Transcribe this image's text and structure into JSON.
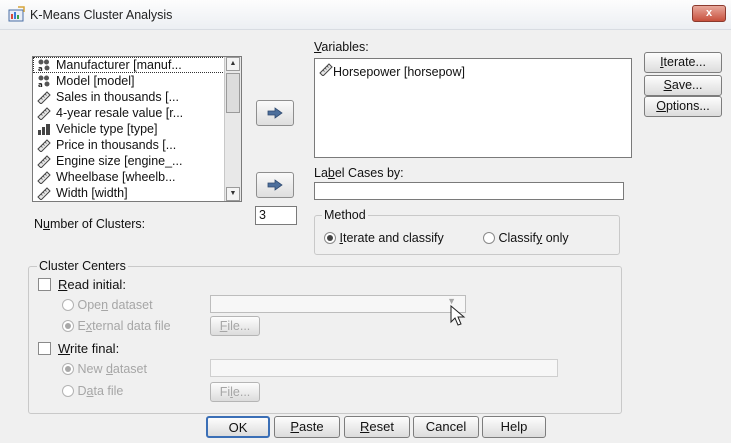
{
  "window": {
    "title": "K-Means Cluster Analysis",
    "close_label": "x"
  },
  "source_variables": [
    {
      "label": "Manufacturer [manuf...",
      "icon": "nominal-string-icon"
    },
    {
      "label": "Model [model]",
      "icon": "nominal-string-icon"
    },
    {
      "label": "Sales in thousands [...",
      "icon": "scale-ruler-icon"
    },
    {
      "label": "4-year resale value [r...",
      "icon": "scale-ruler-icon"
    },
    {
      "label": "Vehicle type [type]",
      "icon": "ordinal-bar-icon"
    },
    {
      "label": "Price in thousands [...",
      "icon": "scale-ruler-icon"
    },
    {
      "label": "Engine size [engine_...",
      "icon": "scale-ruler-icon"
    },
    {
      "label": "Wheelbase [wheelb...",
      "icon": "scale-ruler-icon"
    },
    {
      "label": "Width [width]",
      "icon": "scale-ruler-icon"
    }
  ],
  "variables": {
    "label_pre": "",
    "label_key": "V",
    "label_post": "ariables:",
    "items": [
      {
        "label": "Horsepower [horsepow]",
        "icon": "scale-ruler-icon"
      }
    ]
  },
  "label_cases": {
    "label_pre": "La",
    "label_key": "b",
    "label_post": "el Cases by:",
    "value": ""
  },
  "side_buttons": {
    "iterate": {
      "pre": "",
      "key": "I",
      "post": "terate..."
    },
    "save": {
      "pre": "",
      "key": "S",
      "post": "ave..."
    },
    "options": {
      "pre": "",
      "key": "O",
      "post": "ptions..."
    }
  },
  "clusters": {
    "label_pre": "N",
    "label_key": "u",
    "label_post": "mber of Clusters:",
    "value": "3"
  },
  "method": {
    "title": "Method",
    "iterate": {
      "pre": "",
      "key": "I",
      "post": "terate and classify",
      "selected": true
    },
    "classify": {
      "pre": "Classif",
      "key": "y",
      "post": " only",
      "selected": false
    }
  },
  "cluster_centers": {
    "title": "Cluster Centers",
    "read_initial": {
      "pre": "",
      "key": "R",
      "post": "ead initial:",
      "checked": false
    },
    "open_dataset": {
      "pre": "Ope",
      "key": "n",
      "post": " dataset",
      "selected": false
    },
    "external_file": {
      "pre": "E",
      "key": "x",
      "post": "ternal data file",
      "selected": true
    },
    "file_button_1": {
      "pre": "",
      "key": "F",
      "post": "ile..."
    },
    "write_final": {
      "pre": "",
      "key": "W",
      "post": "rite final:",
      "checked": false
    },
    "new_dataset": {
      "pre": "New ",
      "key": "d",
      "post": "ataset",
      "selected": true
    },
    "data_file": {
      "pre": "D",
      "key": "a",
      "post": "ta file",
      "selected": false
    },
    "file_button_2": {
      "pre": "Fi",
      "key": "l",
      "post": "e..."
    }
  },
  "footer": {
    "ok": "OK",
    "paste": {
      "pre": "",
      "key": "P",
      "post": "aste"
    },
    "reset": {
      "pre": "",
      "key": "R",
      "post": "eset"
    },
    "cancel": "Cancel",
    "help": "Help"
  }
}
